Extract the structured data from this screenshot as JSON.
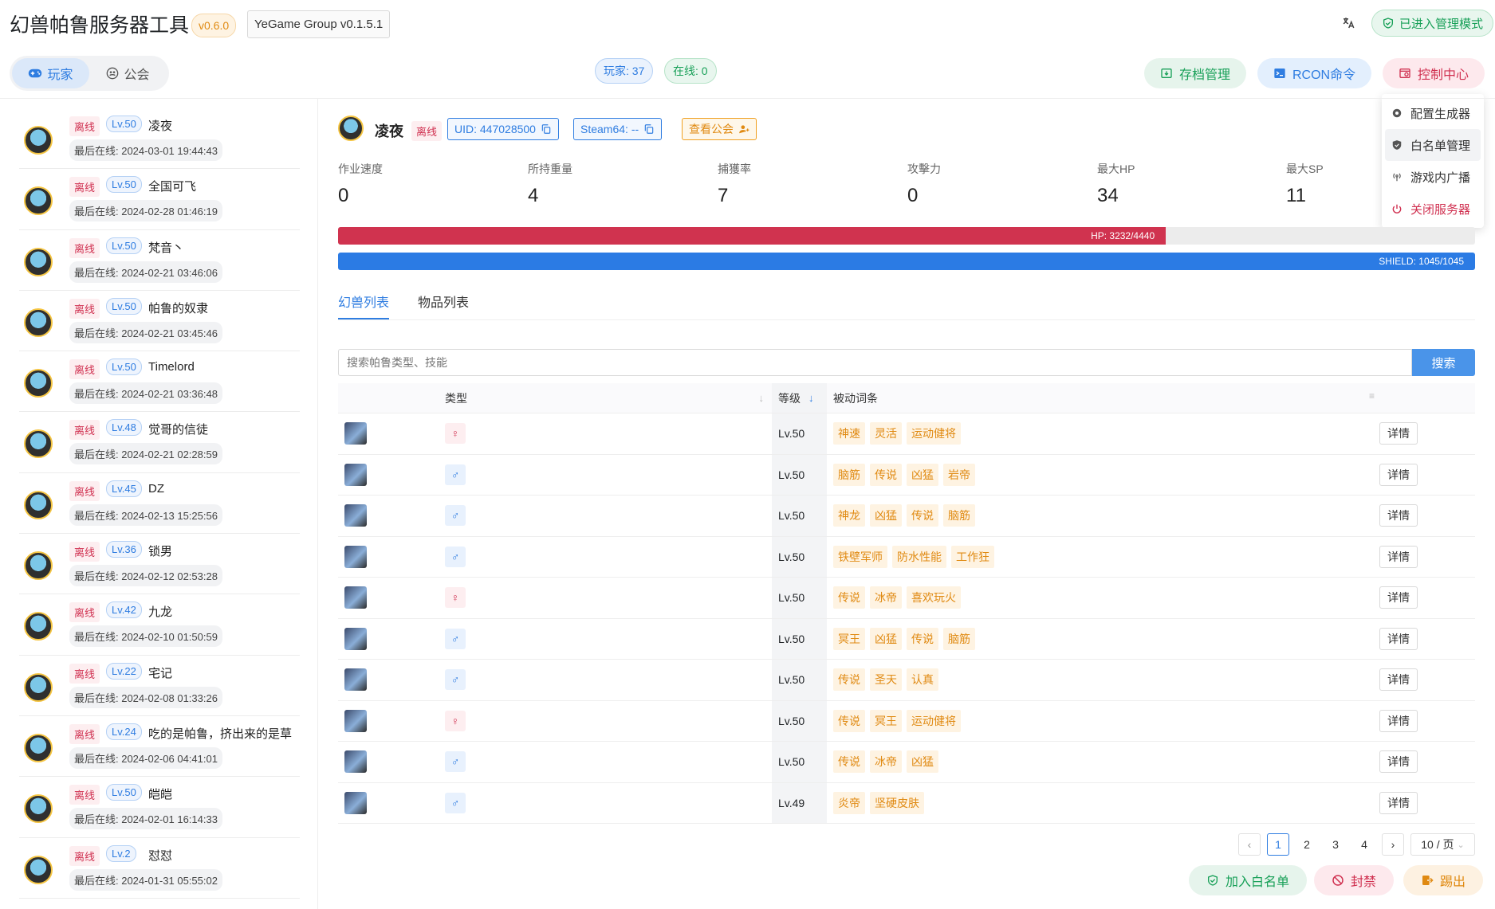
{
  "header": {
    "title": "幻兽帕鲁服务器工具",
    "version": "v0.6.0",
    "group": "YeGame Group v0.1.5.1",
    "admin_mode": "已进入管理模式"
  },
  "segment": {
    "players": "玩家",
    "guilds": "公会"
  },
  "counts": {
    "players": "玩家: 37",
    "online": "在线: 0"
  },
  "actions": {
    "save": "存档管理",
    "rcon": "RCON命令",
    "control": "控制中心"
  },
  "control_menu": [
    "配置生成器",
    "白名单管理",
    "游戏内广播",
    "关闭服务器"
  ],
  "player_list": [
    {
      "status": "离线",
      "level": "Lv.50",
      "name": "凌夜",
      "last_online": "最后在线: 2024-03-01 19:44:43"
    },
    {
      "status": "离线",
      "level": "Lv.50",
      "name": "全国可飞",
      "last_online": "最后在线: 2024-02-28 01:46:19"
    },
    {
      "status": "离线",
      "level": "Lv.50",
      "name": "梵音丶",
      "last_online": "最后在线: 2024-02-21 03:46:06"
    },
    {
      "status": "离线",
      "level": "Lv.50",
      "name": "帕鲁的奴隶",
      "last_online": "最后在线: 2024-02-21 03:45:46"
    },
    {
      "status": "离线",
      "level": "Lv.50",
      "name": "Timelord",
      "last_online": "最后在线: 2024-02-21 03:36:48"
    },
    {
      "status": "离线",
      "level": "Lv.48",
      "name": "觉哥的信徒",
      "last_online": "最后在线: 2024-02-21 02:28:59"
    },
    {
      "status": "离线",
      "level": "Lv.45",
      "name": "DZ",
      "last_online": "最后在线: 2024-02-13 15:25:56"
    },
    {
      "status": "离线",
      "level": "Lv.36",
      "name": "锁男",
      "last_online": "最后在线: 2024-02-12 02:53:28"
    },
    {
      "status": "离线",
      "level": "Lv.42",
      "name": "九龙",
      "last_online": "最后在线: 2024-02-10 01:50:59"
    },
    {
      "status": "离线",
      "level": "Lv.22",
      "name": "宅记",
      "last_online": "最后在线: 2024-02-08 01:33:26"
    },
    {
      "status": "离线",
      "level": "Lv.24",
      "name": "吃的是帕鲁，挤出来的是草",
      "last_online": "最后在线: 2024-02-06 04:41:01"
    },
    {
      "status": "离线",
      "level": "Lv.50",
      "name": "皑皑",
      "last_online": "最后在线: 2024-02-01 16:14:33"
    },
    {
      "status": "离线",
      "level": "Lv.2",
      "name": "怼怼",
      "last_online": "最后在线: 2024-01-31 05:55:02"
    }
  ],
  "detail": {
    "name": "凌夜",
    "status": "离线",
    "uid": "UID: 447028500",
    "steam": "Steam64: --",
    "guild": "查看公会",
    "stats": [
      {
        "label": "作业速度",
        "value": "0"
      },
      {
        "label": "所持重量",
        "value": "4"
      },
      {
        "label": "捕獲率",
        "value": "7"
      },
      {
        "label": "攻擊力",
        "value": "0"
      },
      {
        "label": "最大HP",
        "value": "34"
      },
      {
        "label": "最大SP",
        "value": "11"
      }
    ],
    "hp": {
      "text": "HP: 3232/4440",
      "fraction": 0.728
    },
    "shield": {
      "text": "SHIELD: 1045/1045",
      "fraction": 1.0
    }
  },
  "tabs": [
    "幻兽列表",
    "物品列表"
  ],
  "search": {
    "placeholder": "搜索帕鲁类型、技能",
    "button": "搜索"
  },
  "table": {
    "headers": {
      "type": "类型",
      "level": "等级",
      "passive": "被动词条"
    },
    "rows": [
      {
        "gender": "♀",
        "g": "f",
        "name": "",
        "level": "Lv.50",
        "traits": [
          "神速",
          "灵活",
          "运动健将"
        ]
      },
      {
        "gender": "♂",
        "g": "m",
        "name": "",
        "level": "Lv.50",
        "traits": [
          "脑筋",
          "传说",
          "凶猛",
          "岩帝"
        ]
      },
      {
        "gender": "♂",
        "g": "m",
        "name": "",
        "level": "Lv.50",
        "traits": [
          "神龙",
          "凶猛",
          "传说",
          "脑筋"
        ]
      },
      {
        "gender": "♂",
        "g": "m",
        "name": "",
        "level": "Lv.50",
        "traits": [
          "铁壁军师",
          "防水性能",
          "工作狂"
        ]
      },
      {
        "gender": "♀",
        "g": "f",
        "name": "",
        "level": "Lv.50",
        "traits": [
          "传说",
          "冰帝",
          "喜欢玩火"
        ]
      },
      {
        "gender": "♂",
        "g": "m",
        "name": "",
        "level": "Lv.50",
        "traits": [
          "冥王",
          "凶猛",
          "传说",
          "脑筋"
        ]
      },
      {
        "gender": "♂",
        "g": "m",
        "name": "",
        "level": "Lv.50",
        "traits": [
          "传说",
          "圣天",
          "认真"
        ]
      },
      {
        "gender": "♀",
        "g": "f",
        "name": "",
        "level": "Lv.50",
        "traits": [
          "传说",
          "冥王",
          "运动健将"
        ]
      },
      {
        "gender": "♂",
        "g": "m",
        "name": "",
        "level": "Lv.50",
        "traits": [
          "传说",
          "冰帝",
          "凶猛"
        ]
      },
      {
        "gender": "♂",
        "g": "m",
        "name": "",
        "level": "Lv.49",
        "traits": [
          "炎帝",
          "坚硬皮肤"
        ]
      }
    ],
    "detail_label": "详情"
  },
  "pagination": {
    "prev": "‹",
    "pages": [
      "1",
      "2",
      "3",
      "4"
    ],
    "current": "1",
    "next": "›",
    "page_size": "10 / 页"
  },
  "bottom": {
    "whitelist": "加入白名单",
    "ban": "封禁",
    "kick": "踢出"
  },
  "colors": {
    "primary": "#2f7de1",
    "success": "#18a058",
    "danger": "#d03050",
    "warning": "#e08a12"
  }
}
